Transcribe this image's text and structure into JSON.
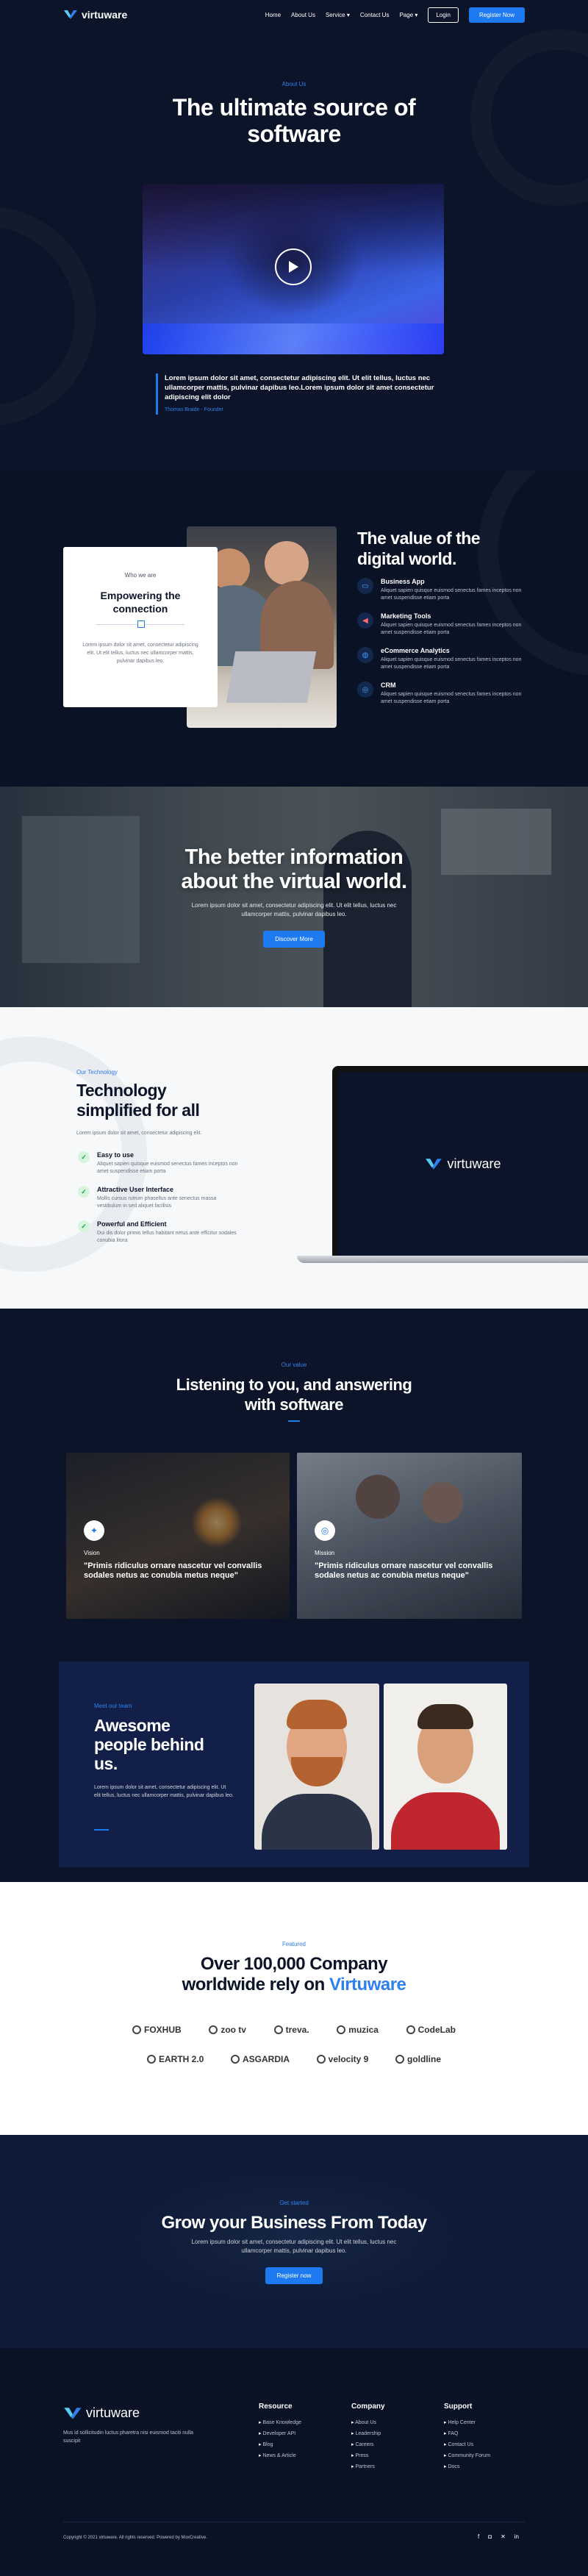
{
  "nav": {
    "logo": "virtuware",
    "items": [
      "Home",
      "About Us",
      "Service",
      "Contact Us",
      "Page"
    ],
    "login": "Login",
    "register": "Register Now"
  },
  "hero": {
    "eyebrow": "About Us",
    "title_line1": "The ultimate source of",
    "title_line2": "software",
    "quote": "Lorem ipsum dolor sit amet, consectetur adipiscing elit. Ut elit tellus, luctus nec ullamcorper mattis, pulvinar dapibus leo.Lorem ipsum dolor sit amet consectetur adipiscing elit dolor",
    "quote_author": "Thomas Braide - Founder"
  },
  "value": {
    "card_eyebrow": "Who we are",
    "card_title": "Empowering the connection",
    "card_text": "Lorem ipsum dolor sit amet, consectetur adipiscing elit. Ut elit tellus, luctus nec ullamcorper mattis, pulvinar dapibus leo.",
    "title_line1": "The value of the",
    "title_line2": "digital world.",
    "features": [
      {
        "icon": "monitor-icon",
        "title": "Business App",
        "text": "Aliquet sapien quisque euismod senectus fames inceptos non amet suspendisse etiam porta"
      },
      {
        "icon": "megaphone-icon",
        "title": "Marketing Tools",
        "text": "Aliquet sapien quisque euismod senectus fames inceptos non amet suspendisse etiam porta"
      },
      {
        "icon": "globe-icon",
        "title": "eCommerce Analytics",
        "text": "Aliquet sapien quisque euismod senectus fames inceptos non amet suspendisse etiam porta"
      },
      {
        "icon": "target-icon",
        "title": "CRM",
        "text": "Aliquet sapien quisque euismod senectus fames inceptos non amet suspendisse etiam porta"
      }
    ]
  },
  "banner": {
    "title_line1": "The better information",
    "title_line2": "about the virtual world.",
    "text": "Lorem ipsum dolor sit amet, consectetur adipiscing elit. Ut elit tellus, luctus nec ullamcorper mattis, pulvinar dapibus leo.",
    "button": "Discover More"
  },
  "tech": {
    "eyebrow": "Our Technology",
    "title_line1": "Technology",
    "title_line2": "simplified for all",
    "intro": "Lorem ipsum dolor sit amet, consectetur adipiscing elit.",
    "items": [
      {
        "title": "Easy to use",
        "text": "Aliquet sapien quisque euismod senectus fames inceptos non amet suspendisse etiam porta"
      },
      {
        "title": "Attractive User Interface",
        "text": "Mollis cursus rutrum phasellus ante senectus massa vestibulum in sed aliquet facilisis"
      },
      {
        "title": "Powerful and Efficient",
        "text": "Dui dis dolor primis tellus habitant netus ante efficitur sodales conubia litora"
      }
    ],
    "screen_logo": "virtuware"
  },
  "values": {
    "eyebrow": "Our value",
    "title_line1": "Listening to you, and answering",
    "title_line2": "with software",
    "cards": [
      {
        "icon": "lightbulb-icon",
        "label": "Vision",
        "text": "\"Primis ridiculus ornare nascetur vel convallis sodales netus ac conubia metus neque\""
      },
      {
        "icon": "target-icon",
        "label": "Mission",
        "text": "\"Primis ridiculus ornare nascetur vel convallis sodales netus ac conubia metus neque\""
      }
    ]
  },
  "team": {
    "eyebrow": "Meet our team",
    "title_line1": "Awesome",
    "title_line2": "people behind",
    "title_line3": "us.",
    "text": "Lorem ipsum dolor sit amet, consectetur adipiscing elit. Ut elit tellus, luctus nec ullamcorper mattis, pulvinar dapibus leo."
  },
  "clients": {
    "eyebrow": "Featured",
    "title_line1": "Over 100,000 Company",
    "title_line2_a": "worldwide rely on ",
    "title_line2_b": "Virtuware",
    "brands_row1": [
      "FOXHUB",
      "zoo tv",
      "treva.",
      "muzica",
      "CodeLab"
    ],
    "brands_row2": [
      "EARTH 2.0",
      "ASGARDIA",
      "velocity 9",
      "goldline"
    ]
  },
  "cta": {
    "eyebrow": "Get started",
    "title": "Grow your Business From Today",
    "text": "Lorem ipsum dolor sit amet, consectetur adipiscing elit. Ut elit tellus, luctus nec ullamcorper mattis, pulvinar dapibus leo.",
    "button": "Register now"
  },
  "footer": {
    "logo": "virtuware",
    "tagline": "Mus id sollicitudin luctus pharetra nisi euismod taciti nulla suscipit",
    "resource": {
      "title": "Resource",
      "links": [
        "Base Knowledge",
        "Developer API",
        "Blog",
        "News & Article"
      ]
    },
    "company": {
      "title": "Company",
      "links": [
        "About Us",
        "Leadership",
        "Careers",
        "Press",
        "Partners"
      ]
    },
    "support": {
      "title": "Support",
      "links": [
        "Help Center",
        "FAQ",
        "Contact Us",
        "Community Forum",
        "Docs"
      ]
    },
    "copyright": "Copyright © 2021 virtuware. All rights reserved. Powered by MoxCreative.",
    "social_icons": [
      "facebook-icon",
      "instagram-icon",
      "twitter-icon",
      "linkedin-icon"
    ]
  },
  "colors": {
    "accent": "#1e7af0",
    "navy": "#0b1428",
    "white": "#ffffff"
  }
}
